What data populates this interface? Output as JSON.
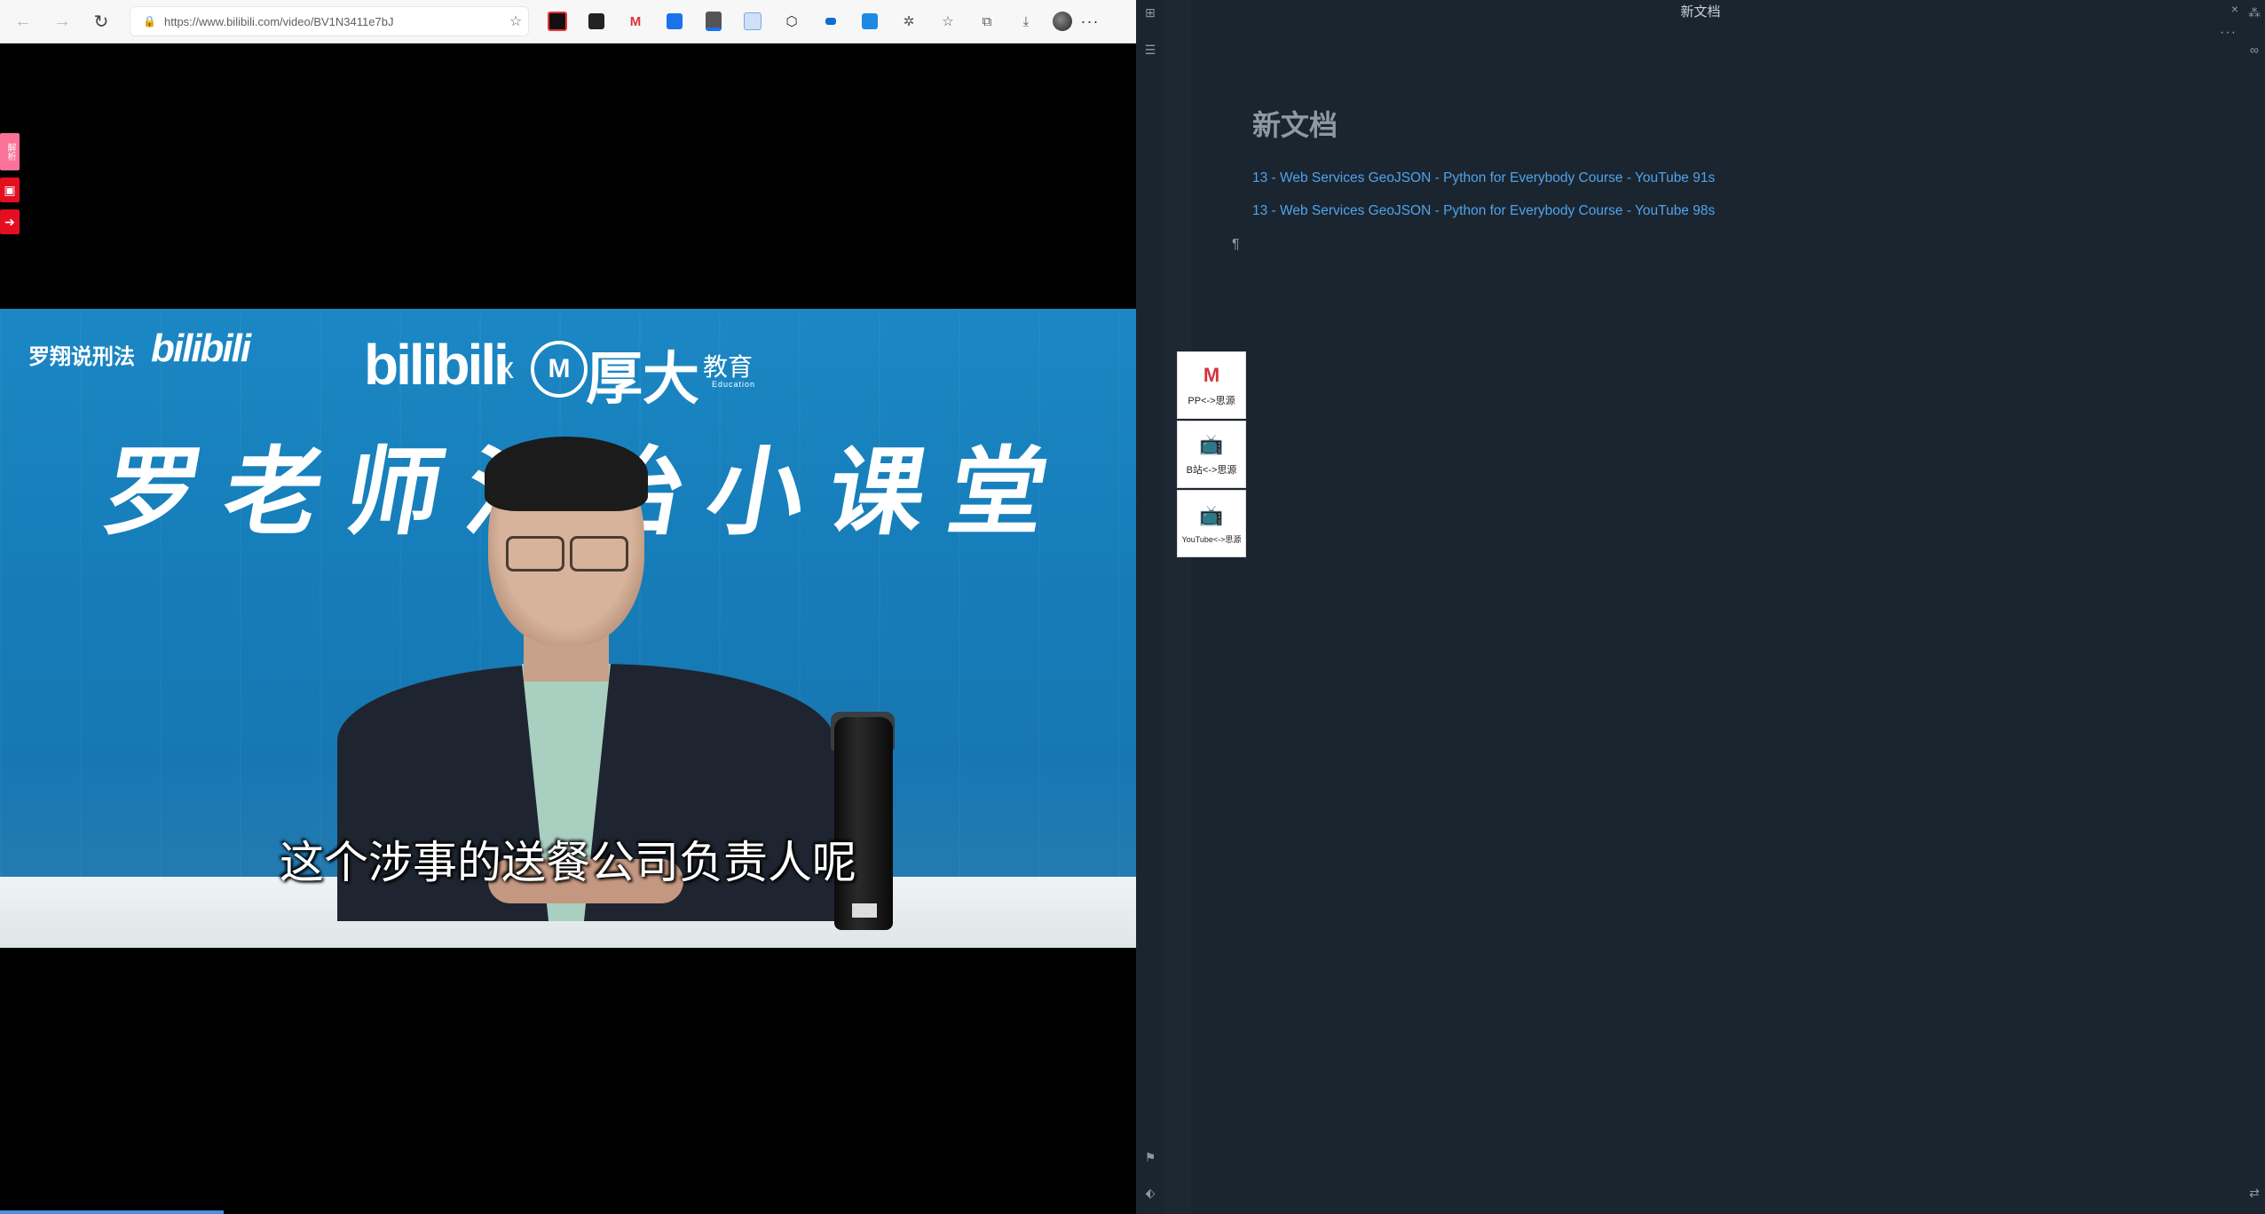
{
  "browser": {
    "url": "https://www.bilibili.com/video/BV1N3411e7bJ",
    "nav": {
      "back": "←",
      "forward": "→",
      "reload": "↻"
    },
    "lock_icon": "🔒",
    "favorite_icon": "☆",
    "extensions": [
      "ext-1",
      "ext-2",
      "ext-3",
      "ext-4",
      "ext-5",
      "ext-6",
      "ext-7",
      "ext-8",
      "ext-9",
      "ext-10"
    ],
    "more_label": "···",
    "side_tools": {
      "first_label": "解析",
      "second_icon": "▣",
      "third_icon": "➔"
    }
  },
  "video": {
    "channel": "罗翔说刑法",
    "channel_logo": "bilibili",
    "brand": "bilibili",
    "cross": "x",
    "partner_mark": "M",
    "partner_name": "厚大",
    "partner_sub": "教育",
    "partner_en": "Education",
    "course_title": "罗老师法治小课堂",
    "subtitle": "这个涉事的送餐公司负责人呢"
  },
  "editor": {
    "title": "新文档",
    "close": "×",
    "more": "···",
    "heading": "新文档",
    "links": [
      "13 - Web Services GeoJSON - Python for Everybody Course - YouTube 91s",
      "13 - Web Services GeoJSON - Python for Everybody Course - YouTube 98s"
    ],
    "pilcrow": "¶",
    "converters": [
      {
        "label": "PP<->思源"
      },
      {
        "label": "B站<->思源"
      },
      {
        "label": "YouTube<->思源"
      }
    ]
  },
  "colors": {
    "editor_bg": "#1b2530",
    "link": "#4fa3ea",
    "heading": "#8f99a4",
    "bilibili_pink": "#fb7299"
  }
}
